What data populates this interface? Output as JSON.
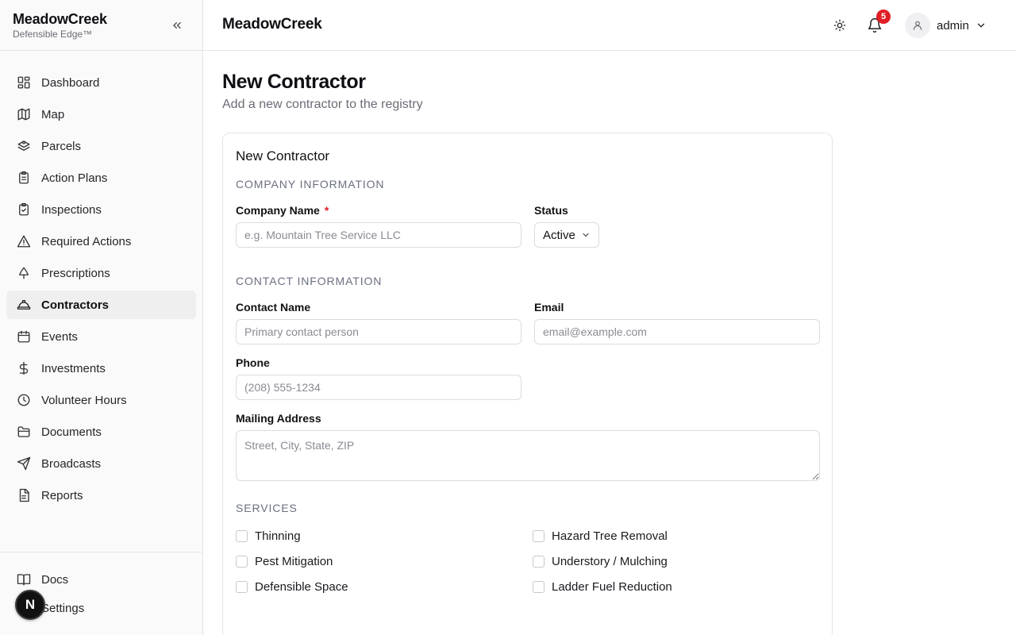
{
  "sidebar": {
    "brand": "MeadowCreek",
    "brand_sub": "Defensible Edge™",
    "items": [
      {
        "label": "Dashboard",
        "icon": "dashboard-icon"
      },
      {
        "label": "Map",
        "icon": "map-icon"
      },
      {
        "label": "Parcels",
        "icon": "parcels-icon"
      },
      {
        "label": "Action Plans",
        "icon": "clipboard-icon"
      },
      {
        "label": "Inspections",
        "icon": "clipboard-check-icon"
      },
      {
        "label": "Required Actions",
        "icon": "warning-icon"
      },
      {
        "label": "Prescriptions",
        "icon": "tree-icon"
      },
      {
        "label": "Contractors",
        "icon": "hard-hat-icon",
        "active": true
      },
      {
        "label": "Events",
        "icon": "calendar-icon"
      },
      {
        "label": "Investments",
        "icon": "dollar-icon"
      },
      {
        "label": "Volunteer Hours",
        "icon": "clock-icon"
      },
      {
        "label": "Documents",
        "icon": "folder-icon"
      },
      {
        "label": "Broadcasts",
        "icon": "send-icon"
      },
      {
        "label": "Reports",
        "icon": "report-icon"
      }
    ],
    "bottom_items": [
      {
        "label": "Docs",
        "icon": "book-icon"
      },
      {
        "label": "Settings",
        "icon": "settings-icon"
      }
    ],
    "fab_label": "N"
  },
  "header": {
    "title": "MeadowCreek",
    "notification_count": "5",
    "user": "admin"
  },
  "page": {
    "title": "New Contractor",
    "subtitle": "Add a new contractor to the registry"
  },
  "form": {
    "card_title": "New Contractor",
    "company_section": "COMPANY INFORMATION",
    "company_name_label": "Company Name",
    "required_mark": "*",
    "company_name_placeholder": "e.g. Mountain Tree Service LLC",
    "status_label": "Status",
    "status_value": "Active",
    "contact_section": "CONTACT INFORMATION",
    "contact_name_label": "Contact Name",
    "contact_name_placeholder": "Primary contact person",
    "email_label": "Email",
    "email_placeholder": "email@example.com",
    "phone_label": "Phone",
    "phone_placeholder": "(208) 555-1234",
    "address_label": "Mailing Address",
    "address_placeholder": "Street, City, State, ZIP",
    "services_section": "SERVICES",
    "services": [
      {
        "label": "Thinning",
        "checked": false
      },
      {
        "label": "Hazard Tree Removal",
        "checked": false
      },
      {
        "label": "Pest Mitigation",
        "checked": false
      },
      {
        "label": "Understory / Mulching",
        "checked": false
      },
      {
        "label": "Defensible Space",
        "checked": false
      },
      {
        "label": "Ladder Fuel Reduction",
        "checked": false
      }
    ]
  }
}
